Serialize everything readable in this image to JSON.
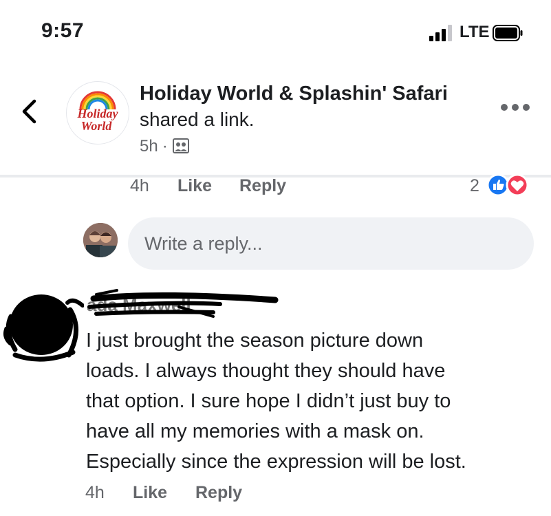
{
  "status_bar": {
    "time": "9:57",
    "network": "LTE"
  },
  "header": {
    "page_name": "Holiday World & Splashin' Safari",
    "action": "shared a link.",
    "time_ago": "5h",
    "separator": "·",
    "logo_text_top": "Holiday",
    "logo_text_bottom": "World"
  },
  "previous_reply": {
    "time": "4h",
    "like_label": "Like",
    "reply_label": "Reply",
    "reaction_count": "2"
  },
  "composer": {
    "placeholder": "Write a reply..."
  },
  "comment": {
    "author": "ada Maxwell",
    "lines": [
      "I just brought the season picture down",
      "loads. I always thought they should have",
      "that option. I sure hope I didn’t just buy to",
      "have all my memories with a mask on.",
      "Especially since the expression will be lost."
    ],
    "time": "4h",
    "like_label": "Like",
    "reply_label": "Reply"
  },
  "colors": {
    "like_blue": "#1877f2",
    "love_red": "#f33e58",
    "secondary_text": "#65676b",
    "composer_bg": "#f0f2f5"
  }
}
